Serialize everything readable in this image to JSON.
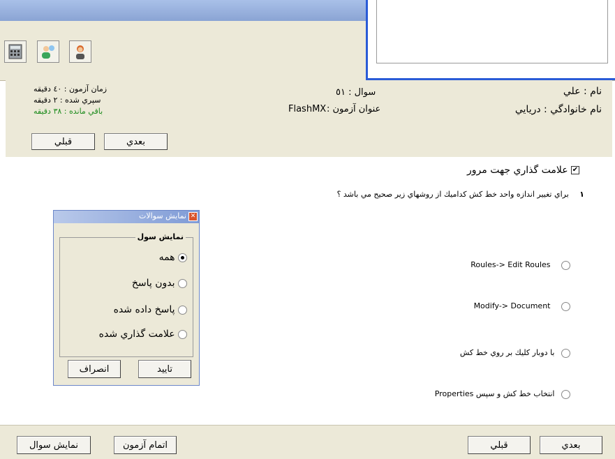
{
  "header": {
    "name": "نام : علي",
    "family": "نام خانوادگي : دريايي",
    "question": "سوال : ٥١",
    "exam_title_label": "عنوان آزمون :",
    "exam_title_value": "FlashMX",
    "exam_time": "زمان آزمون : ٤٠ دقيقه",
    "elapsed": "سپري شده : ٢ دقيقه",
    "remaining": "باقي مانده : ٣٨ دقيقه",
    "next": "بعدي",
    "prev": "قبلي"
  },
  "main": {
    "mark_label": "علامت گذاري جهت مرور",
    "question_number": "١",
    "question_text": "براي تغيير اندازه واحد خط كش كداميك از روشهاي زير صحيح مي باشد ؟",
    "options": [
      "Roules-> Edit Roules",
      "Modify-> Document",
      "با دوبار كليك بر روي خط كش",
      "انتخاب خط كش و سپس Properties"
    ]
  },
  "dialog": {
    "title": "نمايش سوالات",
    "group_label": "نمايش سول",
    "options": [
      "همه",
      "بدون پاسخ",
      "پاسخ داده شده",
      "علامت گذاري شده"
    ],
    "confirm": "تاييد",
    "cancel": "انصراف"
  },
  "footer": {
    "next": "بعدي",
    "prev": "قبلي",
    "finish": "اتمام آزمون",
    "show_questions": "نمايش سوال"
  },
  "colors": {
    "remaining": "#1a8a1a",
    "accent": "#2a5bd7"
  },
  "icons": [
    "calculator-icon",
    "users-icon",
    "operator-icon"
  ]
}
